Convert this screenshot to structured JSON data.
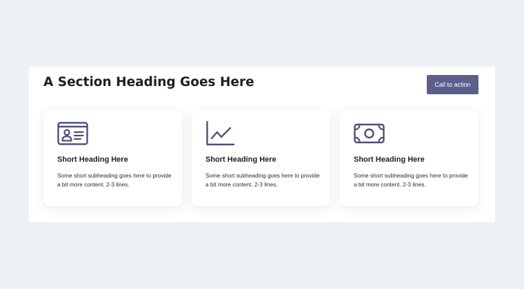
{
  "section": {
    "title": "A Section Heading Goes Here",
    "cta_label": "Call to action"
  },
  "colors": {
    "page_background": "#edf0f4",
    "section_background": "#ffffff",
    "accent": "#5c5f8c",
    "icon_stroke": "#4e5078",
    "heading_text": "#1e1e26"
  },
  "cards": [
    {
      "icon": "id-card-icon",
      "heading": "Short Heading Here",
      "text": "Some short subheading goes here to provide a bit more content. 2-3 lines."
    },
    {
      "icon": "line-chart-icon",
      "heading": "Short Heading Here",
      "text": "Some short subheading goes here to provide a bit more content. 2-3 lines."
    },
    {
      "icon": "banknote-icon",
      "heading": "Short Heading Here",
      "text": "Some short subheading goes here to provide a bit more content. 2-3 lines."
    }
  ]
}
